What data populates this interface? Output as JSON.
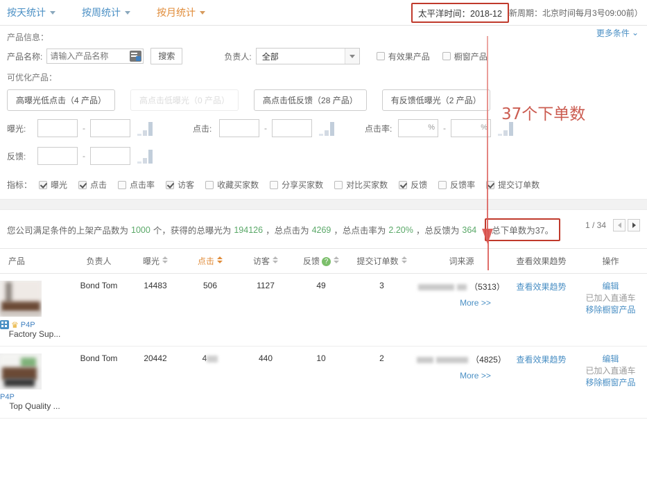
{
  "header": {
    "tabs": [
      {
        "label": "按天统计",
        "active": false
      },
      {
        "label": "按周统计",
        "active": false
      },
      {
        "label": "按月统计",
        "active": true
      }
    ],
    "time_label": "太平洋时间：",
    "time_value": "2018-12",
    "update_note": "更新周期：北京时间每月3号09:00前）"
  },
  "filter": {
    "section_label": "产品信息：",
    "product_name_label": "产品名称:",
    "product_name_placeholder": "请输入产品名称",
    "product_name_value": "",
    "search_button": "搜索",
    "owner_label": "负责人:",
    "owner_value": "全部",
    "checkbox_effective": "有效果产品",
    "checkbox_showcase": "橱窗产品",
    "more_conditions": "更多条件"
  },
  "optimizable": {
    "label": "可优化产品：",
    "buttons": [
      {
        "label": "高曝光低点击（4 产品）",
        "disabled": false
      },
      {
        "label": "高点击低曝光（0 产品）",
        "disabled": true
      },
      {
        "label": "高点击低反馈（28 产品）",
        "disabled": false
      },
      {
        "label": "有反馈低曝光（2 产品）",
        "disabled": false
      }
    ]
  },
  "ranges": {
    "exposure_label": "曝光:",
    "exposure_min": "",
    "exposure_max": "",
    "click_label": "点击:",
    "click_min": "",
    "click_max": "",
    "ctr_label": "点击率:",
    "ctr_min": "",
    "ctr_max": "",
    "feedback_label": "反馈:",
    "feedback_min": "",
    "feedback_max": "",
    "separator": "-"
  },
  "indicators": {
    "label": "指标：",
    "items": [
      {
        "label": "曝光",
        "checked": true
      },
      {
        "label": "点击",
        "checked": true
      },
      {
        "label": "点击率",
        "checked": false
      },
      {
        "label": "访客",
        "checked": true
      },
      {
        "label": "收藏买家数",
        "checked": false
      },
      {
        "label": "分享买家数",
        "checked": false
      },
      {
        "label": "对比买家数",
        "checked": false
      },
      {
        "label": "反馈",
        "checked": true
      },
      {
        "label": "反馈率",
        "checked": false
      },
      {
        "label": "提交订单数",
        "checked": true
      }
    ]
  },
  "summary": {
    "p1": "您公司满足条件的上架产品数为",
    "products": "1000",
    "p2": "个，获得的总曝光为",
    "exposure": "194126",
    "p3": "，总点击为",
    "clicks": "4269",
    "p4": "，总点击率为",
    "ctr": "2.20%",
    "p5": "，总反馈为",
    "feedback": "364",
    "orders_box": "总下单数为37。",
    "page_indicator": "1 / 34"
  },
  "table": {
    "columns": [
      {
        "label": "产品",
        "sortable": false,
        "active": false
      },
      {
        "label": "负责人",
        "sortable": false,
        "active": false
      },
      {
        "label": "曝光",
        "sortable": true,
        "active": false
      },
      {
        "label": "点击",
        "sortable": true,
        "active": true
      },
      {
        "label": "访客",
        "sortable": true,
        "active": false
      },
      {
        "label": "反馈",
        "sortable": true,
        "active": false,
        "help": "?"
      },
      {
        "label": "提交订单数",
        "sortable": true,
        "active": false
      },
      {
        "label": "词来源",
        "sortable": false,
        "active": false
      },
      {
        "label": "查看效果趋势",
        "sortable": false,
        "active": false
      },
      {
        "label": "操作",
        "sortable": false,
        "active": false
      }
    ],
    "rows": [
      {
        "product_name": "Factory Sup...",
        "badge_p4p": "P4P",
        "has_showcase_badge": true,
        "has_crown_badge": true,
        "owner": "Bond Tom",
        "exposure": "14483",
        "clicks": "506",
        "visitors": "1127",
        "feedback": "49",
        "orders": "3",
        "keyword_count": "（5313）",
        "more_label": "More >>",
        "trend_link": "查看效果趋势",
        "op_edit": "编辑",
        "op_added": "已加入直通车",
        "op_remove": "移除橱窗产品"
      },
      {
        "product_name": "Top Quality ...",
        "badge_p4p": "P4P",
        "has_showcase_badge": false,
        "has_crown_badge": false,
        "owner": "Bond Tom",
        "exposure": "20442",
        "clicks": "4",
        "visitors": "440",
        "feedback": "10",
        "orders": "2",
        "keyword_count": "（4825）",
        "more_label": "More >>",
        "trend_link": "查看效果趋势",
        "op_edit": "编辑",
        "op_added": "已加入直通车",
        "op_remove": "移除橱窗产品"
      }
    ]
  },
  "annotation": {
    "text": "37个下单数",
    "color": "#c0392b"
  }
}
